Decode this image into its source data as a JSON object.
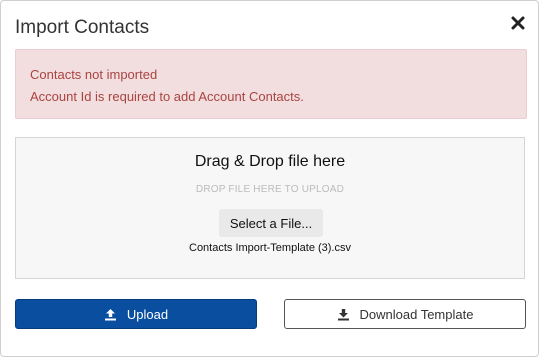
{
  "dialog": {
    "title": "Import Contacts",
    "close_icon": "close-x-icon"
  },
  "alert": {
    "heading": "Contacts not imported",
    "message": "Account Id is required to add Account Contacts."
  },
  "dropzone": {
    "title": "Drag & Drop file here",
    "hint": "DROP FILE HERE TO UPLOAD",
    "select_label": "Select a File...",
    "filename": "Contacts Import-Template (3).csv"
  },
  "actions": {
    "upload_label": "Upload",
    "upload_icon": "upload-icon",
    "download_label": "Download Template",
    "download_icon": "download-icon"
  },
  "colors": {
    "primary": "#0a4ea0",
    "alert_bg": "#f2dede",
    "alert_text": "#a94442"
  }
}
